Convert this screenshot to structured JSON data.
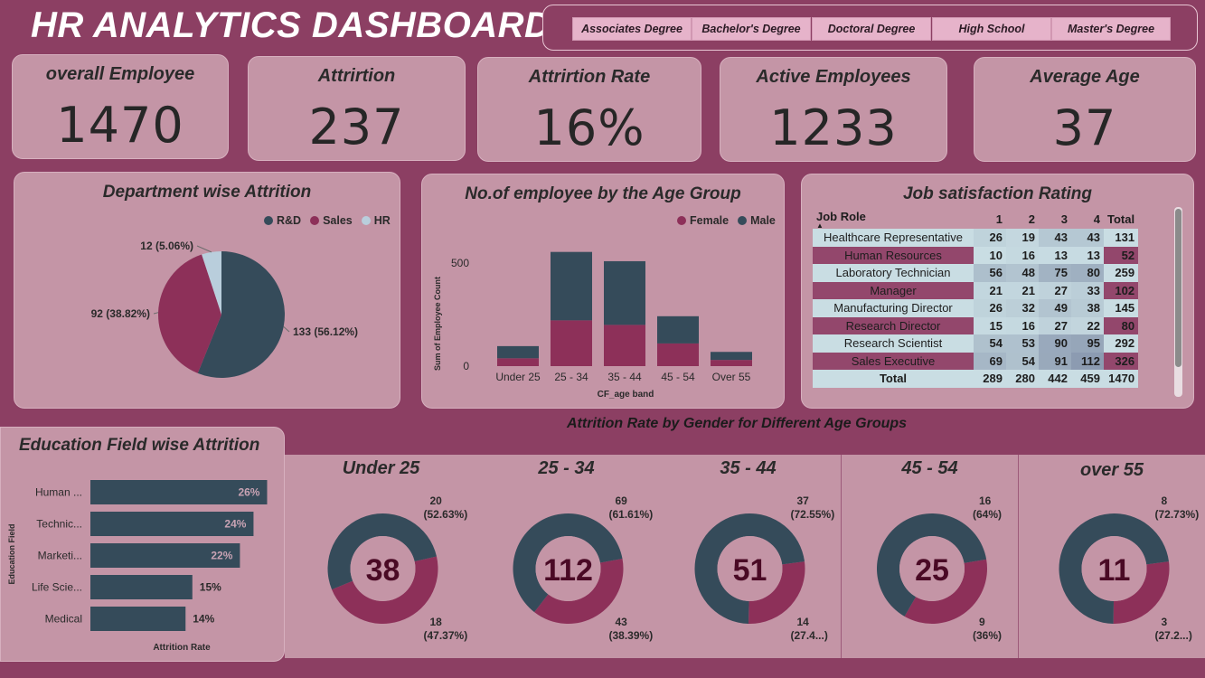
{
  "title": "HR ANALYTICS DASHBOARD",
  "education_slicer": [
    "Associates Degree",
    "Bachelor's Degree",
    "Doctoral Degree",
    "High School",
    "Master's Degree"
  ],
  "kpis": [
    {
      "label": "overall Employee",
      "value": "1470"
    },
    {
      "label": "Attrirtion",
      "value": "237"
    },
    {
      "label": "Attrirtion Rate",
      "value": "16%"
    },
    {
      "label": "Active Employees",
      "value": "1233"
    },
    {
      "label": "Average Age",
      "value": "37"
    }
  ],
  "colors": {
    "dark": "#354b5a",
    "maroon": "#8d3059",
    "light_blue": "#b9cedc",
    "number": "#4a0a25"
  },
  "chart_data": [
    {
      "type": "pie",
      "title": "Department wise Attrition",
      "legend": [
        "R&D",
        "Sales",
        "HR"
      ],
      "legend_position": "top-right",
      "categories": [
        "R&D",
        "Sales",
        "HR"
      ],
      "values": [
        133,
        92,
        12
      ],
      "labels": [
        "133 (56.12%)",
        "92 (38.82%)",
        "12 (5.06%)"
      ]
    },
    {
      "type": "bar",
      "stacked": true,
      "title": "No.of employee by the Age Group",
      "xlabel": "CF_age band",
      "ylabel": "Sum of Employee Count",
      "categories": [
        "Under 25",
        "25 - 34",
        "35 - 44",
        "45 - 54",
        "Over 55"
      ],
      "series": [
        {
          "name": "Female",
          "values": [
            38,
            222,
            200,
            110,
            30
          ]
        },
        {
          "name": "Male",
          "values": [
            59,
            332,
            309,
            132,
            39
          ]
        }
      ],
      "yticks": [
        "0",
        "500"
      ],
      "ylim": [
        0,
        650
      ],
      "legend_position": "top-right"
    },
    {
      "type": "table",
      "title": "Job satisfaction Rating",
      "columns": [
        "Job Role",
        "1",
        "2",
        "3",
        "4",
        "Total"
      ],
      "rows": [
        [
          "Healthcare Representative",
          "26",
          "19",
          "43",
          "43",
          "131"
        ],
        [
          "Human Resources",
          "10",
          "16",
          "13",
          "13",
          "52"
        ],
        [
          "Laboratory Technician",
          "56",
          "48",
          "75",
          "80",
          "259"
        ],
        [
          "Manager",
          "21",
          "21",
          "27",
          "33",
          "102"
        ],
        [
          "Manufacturing Director",
          "26",
          "32",
          "49",
          "38",
          "145"
        ],
        [
          "Research Director",
          "15",
          "16",
          "27",
          "22",
          "80"
        ],
        [
          "Research Scientist",
          "54",
          "53",
          "90",
          "95",
          "292"
        ],
        [
          "Sales Executive",
          "69",
          "54",
          "91",
          "112",
          "326"
        ]
      ],
      "total_row": [
        "Total",
        "289",
        "280",
        "442",
        "459",
        "1470"
      ]
    },
    {
      "type": "bar",
      "orientation": "horizontal",
      "title": "Education Field wise Attrition",
      "xlabel": "Attrition Rate",
      "ylabel": "Education Field",
      "categories": [
        "Human ...",
        "Technic...",
        "Marketi...",
        "Life Scie...",
        "Medical"
      ],
      "values": [
        26,
        24,
        22,
        15,
        14
      ],
      "labels": [
        "26%",
        "24%",
        "22%",
        "15%",
        "14%"
      ],
      "xlim": [
        0,
        27
      ]
    },
    {
      "type": "pie",
      "donut": true,
      "section_title": "Attrition Rate by Gender for Different Age Groups",
      "groups": [
        {
          "title": "Under 25",
          "total": "38",
          "dark_value": 20,
          "maroon_value": 18,
          "dark_label": [
            "20",
            "(52.63%)"
          ],
          "maroon_label": [
            "18",
            "(47.37%)"
          ]
        },
        {
          "title": "25 - 34",
          "total": "112",
          "dark_value": 69,
          "maroon_value": 43,
          "dark_label": [
            "69",
            "(61.61%)"
          ],
          "maroon_label": [
            "43",
            "(38.39%)"
          ]
        },
        {
          "title": "35 - 44",
          "total": "51",
          "dark_value": 37,
          "maroon_value": 14,
          "dark_label": [
            "37",
            "(72.55%)"
          ],
          "maroon_label": [
            "14",
            "(27.4...)"
          ]
        },
        {
          "title": "45 - 54",
          "total": "25",
          "dark_value": 16,
          "maroon_value": 9,
          "dark_label": [
            "16",
            "(64%)"
          ],
          "maroon_label": [
            "9",
            "(36%)"
          ]
        },
        {
          "title": "over 55",
          "total": "11",
          "dark_value": 8,
          "maroon_value": 3,
          "dark_label": [
            "8",
            "(72.73%)"
          ],
          "maroon_label": [
            "3",
            "(27.2...)"
          ]
        }
      ]
    }
  ]
}
